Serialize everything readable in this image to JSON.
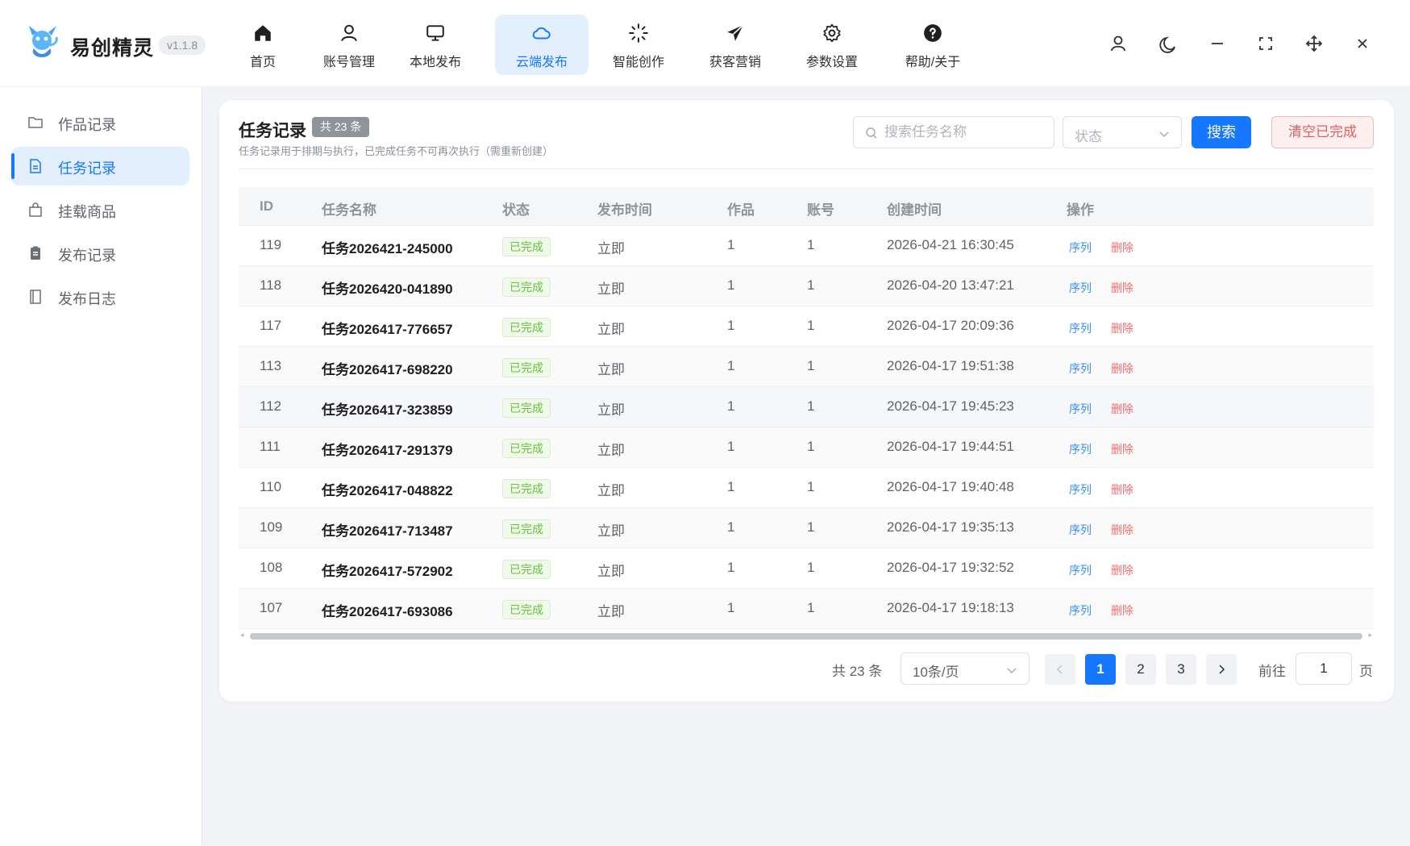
{
  "app": {
    "name": "易创精灵",
    "version": "v1.1.8",
    "logo_caption": "易创精灵"
  },
  "nav": [
    {
      "label": "首页",
      "icon": "home-icon"
    },
    {
      "label": "账号管理",
      "icon": "user-icon"
    },
    {
      "label": "本地发布",
      "icon": "monitor-icon"
    },
    {
      "label": "云端发布",
      "icon": "cloud-icon",
      "active": true
    },
    {
      "label": "智能创作",
      "icon": "sparkle-loader-icon"
    },
    {
      "label": "获客营销",
      "icon": "paper-plane-icon"
    },
    {
      "label": "参数设置",
      "icon": "gear-icon"
    },
    {
      "label": "帮助/关于",
      "icon": "help-circle-icon"
    }
  ],
  "window_controls": [
    "user-icon",
    "moon-icon",
    "minimize-icon",
    "fullscreen-icon",
    "move-icon",
    "close-icon"
  ],
  "sidebar": {
    "items": [
      {
        "label": "作品记录",
        "icon": "folder-icon"
      },
      {
        "label": "任务记录",
        "icon": "document-icon",
        "active": true
      },
      {
        "label": "挂载商品",
        "icon": "shopping-bag-icon"
      },
      {
        "label": "发布记录",
        "icon": "clipboard-icon"
      },
      {
        "label": "发布日志",
        "icon": "book-icon"
      }
    ]
  },
  "main": {
    "title": "任务记录",
    "count_badge": "共 23 条",
    "subtitle": "任务记录用于排期与执行，已完成任务不可再次执行（需重新创建）",
    "search_placeholder": "搜索任务名称",
    "status_placeholder": "状态",
    "search_button": "搜索",
    "clear_button": "清空已完成"
  },
  "table": {
    "columns": [
      "ID",
      "任务名称",
      "状态",
      "发布时间",
      "作品",
      "账号",
      "创建时间",
      "操作"
    ],
    "rows": [
      {
        "id": "119",
        "name": "任务2026421-245000",
        "status": "已完成",
        "publish": "立即",
        "works": "1",
        "account": "1",
        "created": "2026-04-21 16:30:45"
      },
      {
        "id": "118",
        "name": "任务2026420-041890",
        "status": "已完成",
        "publish": "立即",
        "works": "1",
        "account": "1",
        "created": "2026-04-20 13:47:21"
      },
      {
        "id": "117",
        "name": "任务2026417-776657",
        "status": "已完成",
        "publish": "立即",
        "works": "1",
        "account": "1",
        "created": "2026-04-17 20:09:36"
      },
      {
        "id": "113",
        "name": "任务2026417-698220",
        "status": "已完成",
        "publish": "立即",
        "works": "1",
        "account": "1",
        "created": "2026-04-17 19:51:38"
      },
      {
        "id": "112",
        "name": "任务2026417-323859",
        "status": "已完成",
        "publish": "立即",
        "works": "1",
        "account": "1",
        "created": "2026-04-17 19:45:23"
      },
      {
        "id": "111",
        "name": "任务2026417-291379",
        "status": "已完成",
        "publish": "立即",
        "works": "1",
        "account": "1",
        "created": "2026-04-17 19:44:51"
      },
      {
        "id": "110",
        "name": "任务2026417-048822",
        "status": "已完成",
        "publish": "立即",
        "works": "1",
        "account": "1",
        "created": "2026-04-17 19:40:48"
      },
      {
        "id": "109",
        "name": "任务2026417-713487",
        "status": "已完成",
        "publish": "立即",
        "works": "1",
        "account": "1",
        "created": "2026-04-17 19:35:13"
      },
      {
        "id": "108",
        "name": "任务2026417-572902",
        "status": "已完成",
        "publish": "立即",
        "works": "1",
        "account": "1",
        "created": "2026-04-17 19:32:52"
      },
      {
        "id": "107",
        "name": "任务2026417-693086",
        "status": "已完成",
        "publish": "立即",
        "works": "1",
        "account": "1",
        "created": "2026-04-17 19:18:13"
      }
    ],
    "actions": {
      "queue": "序列",
      "delete": "删除"
    }
  },
  "pagination": {
    "total": "共 23 条",
    "page_size": "10条/页",
    "pages": [
      "1",
      "2",
      "3"
    ],
    "current": "1",
    "goto_label": "前往",
    "goto_value": "1",
    "page_suffix": "页"
  },
  "colors": {
    "accent": "#1677ff",
    "success": "#67c23a",
    "danger": "#f56c6c",
    "link": "#3b8ff7"
  }
}
